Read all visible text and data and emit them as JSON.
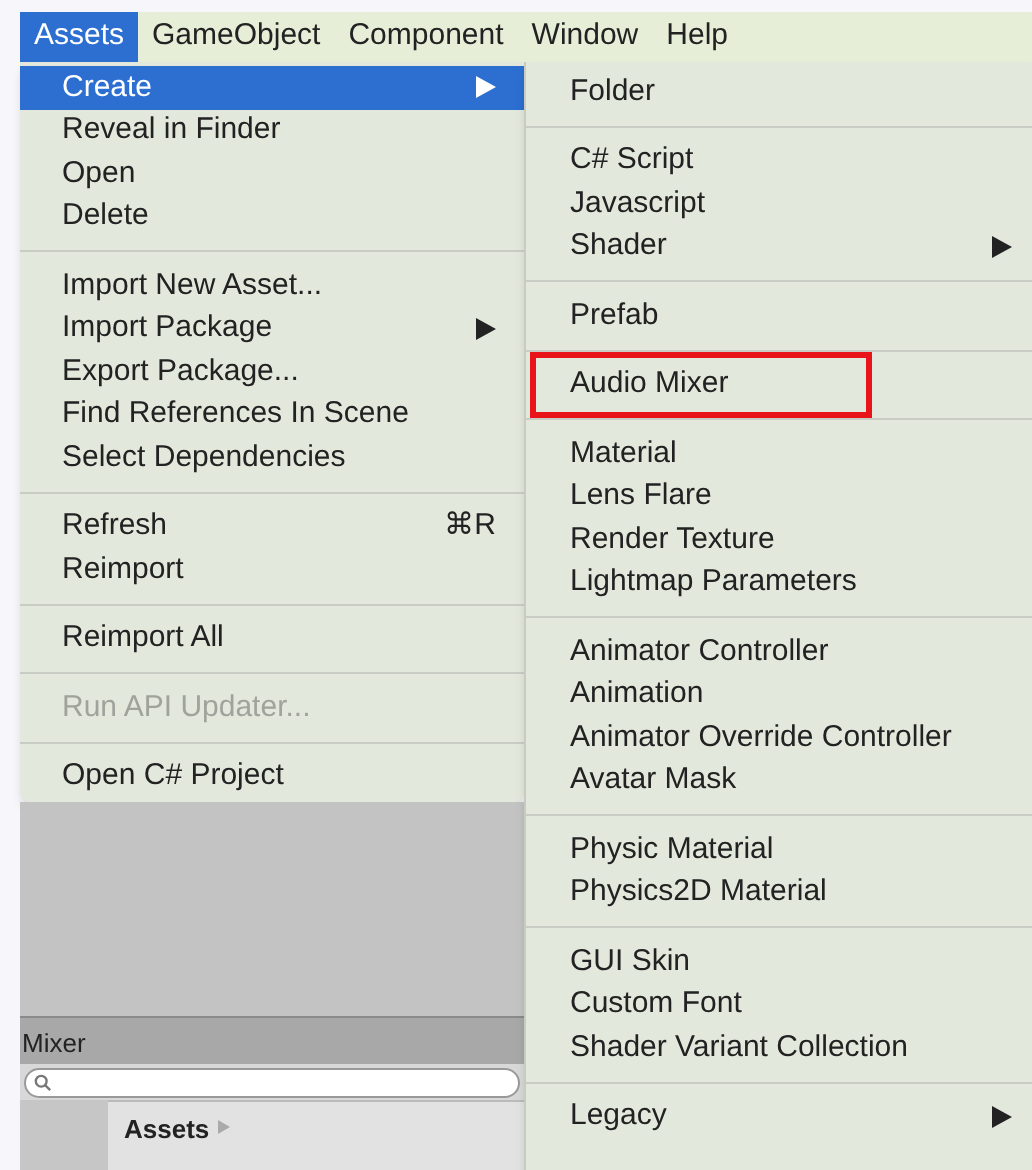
{
  "menubar": [
    {
      "label": "Assets",
      "selected": true
    },
    {
      "label": "GameObject",
      "selected": false
    },
    {
      "label": "Component",
      "selected": false
    },
    {
      "label": "Window",
      "selected": false
    },
    {
      "label": "Help",
      "selected": false
    }
  ],
  "assets_menu": [
    [
      {
        "label": "Create",
        "submenu": true,
        "selected": true,
        "disabled": false
      },
      {
        "label": "Reveal in Finder",
        "submenu": false,
        "selected": false,
        "disabled": false
      },
      {
        "label": "Open",
        "submenu": false,
        "selected": false,
        "disabled": false
      },
      {
        "label": "Delete",
        "submenu": false,
        "selected": false,
        "disabled": false
      }
    ],
    [
      {
        "label": "Import New Asset...",
        "submenu": false,
        "selected": false,
        "disabled": false
      },
      {
        "label": "Import Package",
        "submenu": true,
        "selected": false,
        "disabled": false
      },
      {
        "label": "Export Package...",
        "submenu": false,
        "selected": false,
        "disabled": false
      },
      {
        "label": "Find References In Scene",
        "submenu": false,
        "selected": false,
        "disabled": false
      },
      {
        "label": "Select Dependencies",
        "submenu": false,
        "selected": false,
        "disabled": false
      }
    ],
    [
      {
        "label": "Refresh",
        "shortcut": "⌘R",
        "submenu": false,
        "selected": false,
        "disabled": false
      },
      {
        "label": "Reimport",
        "submenu": false,
        "selected": false,
        "disabled": false
      }
    ],
    [
      {
        "label": "Reimport All",
        "submenu": false,
        "selected": false,
        "disabled": false
      }
    ],
    [
      {
        "label": "Run API Updater...",
        "submenu": false,
        "selected": false,
        "disabled": true
      }
    ],
    [
      {
        "label": "Open C# Project",
        "submenu": false,
        "selected": false,
        "disabled": false
      }
    ]
  ],
  "create_submenu": [
    [
      {
        "label": "Folder",
        "submenu": false,
        "outlined": false
      }
    ],
    [
      {
        "label": "C# Script",
        "submenu": false,
        "outlined": false
      },
      {
        "label": "Javascript",
        "submenu": false,
        "outlined": false
      },
      {
        "label": "Shader",
        "submenu": true,
        "outlined": false
      }
    ],
    [
      {
        "label": "Prefab",
        "submenu": false,
        "outlined": false
      }
    ],
    [
      {
        "label": "Audio Mixer",
        "submenu": false,
        "outlined": true
      }
    ],
    [
      {
        "label": "Material",
        "submenu": false,
        "outlined": false
      },
      {
        "label": "Lens Flare",
        "submenu": false,
        "outlined": false
      },
      {
        "label": "Render Texture",
        "submenu": false,
        "outlined": false
      },
      {
        "label": "Lightmap Parameters",
        "submenu": false,
        "outlined": false
      }
    ],
    [
      {
        "label": "Animator Controller",
        "submenu": false,
        "outlined": false
      },
      {
        "label": "Animation",
        "submenu": false,
        "outlined": false
      },
      {
        "label": "Animator Override Controller",
        "submenu": false,
        "outlined": false
      },
      {
        "label": "Avatar Mask",
        "submenu": false,
        "outlined": false
      }
    ],
    [
      {
        "label": "Physic Material",
        "submenu": false,
        "outlined": false
      },
      {
        "label": "Physics2D Material",
        "submenu": false,
        "outlined": false
      }
    ],
    [
      {
        "label": "GUI Skin",
        "submenu": false,
        "outlined": false
      },
      {
        "label": "Custom Font",
        "submenu": false,
        "outlined": false
      },
      {
        "label": "Shader Variant Collection",
        "submenu": false,
        "outlined": false
      }
    ],
    [
      {
        "label": "Legacy",
        "submenu": true,
        "outlined": false
      }
    ]
  ],
  "mixer_panel": {
    "title": "Mixer",
    "breadcrumb": "Assets"
  }
}
